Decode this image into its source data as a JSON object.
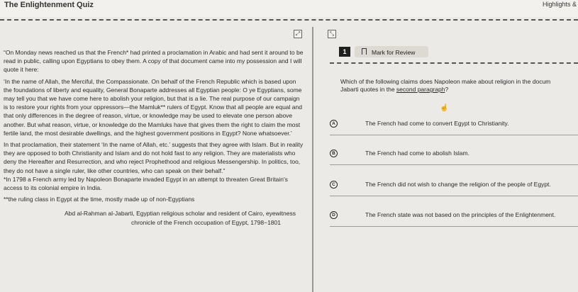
{
  "header": {
    "app_title": "The Enlightenment Quiz",
    "highlights_label": "Highlights &"
  },
  "toolbar": {
    "expand_icon": "expand-icon",
    "collapse_icon": "collapse-icon"
  },
  "passage": {
    "paragraphs": [
      "“On Monday news reached us that the French* had printed a proclamation in Arabic and had sent it around to be read in public, calling upon Egyptians to obey them. A copy of that document came into my possession and I will quote it here:",
      "‘In the name of Allah, the Merciful, the Compassionate. On behalf of the French Republic which is based upon the foundations of liberty and equality, General Bonaparte addresses all Egyptian people: O ye Egyptians, some may tell you that we have come here to abolish your religion, but that is a lie. The real purpose of our campaign is to restore your rights from your oppressors—the Mamluk** rulers of Egypt. Know that all people are equal and that only differences in the degree of reason, virtue, or knowledge may be used to elevate one person above another. But what reason, virtue, or knowledge do the Mamluks have that gives them the right to claim the most fertile land, the most desirable dwellings, and the highest government positions in Egypt? None whatsoever.’",
      "In that proclamation, their statement ‘In the name of Allah, etc.’ suggests that they agree with Islam. But in reality they are opposed to both Christianity and Islam and do not hold fast to any religion. They are materialists who deny the Hereafter and Resurrection, and who reject Prophethood and religious Messengership. In politics, too, they do not have a single ruler, like other countries, who can speak on their behalf.”"
    ],
    "footnote1": "*In 1798 a French army led by Napoleon Bonaparte invaded Egypt in an attempt to threaten Great Britain's access to its colonial empire in India.",
    "footnote2": "**the ruling class in Egypt at the time, mostly made up of non-Egyptians",
    "source_line1": "Abd al-Rahman al-Jabarti, Egyptian religious scholar and resident of Cairo, eyewitness",
    "source_line2": "chronicle of the French occupation of Egypt, 1798−1801"
  },
  "question": {
    "number": "1",
    "mark_for_review": "Mark for Review",
    "stem_line1": "Which of the following claims does Napoleon make about religion in the docum",
    "stem_line2_pre": "Jabarti quotes in the ",
    "stem_line2_underlined": "second paragraph",
    "stem_line2_post": "?",
    "options": [
      {
        "letter": "A",
        "text": "The French had come to convert Egypt to Christianity."
      },
      {
        "letter": "B",
        "text": "The French had come to abolish Islam."
      },
      {
        "letter": "C",
        "text": "The French did not wish to change the religion of the people of Egypt."
      },
      {
        "letter": "D",
        "text": "The French state was not based on the principles of the Enlightenment."
      }
    ]
  }
}
